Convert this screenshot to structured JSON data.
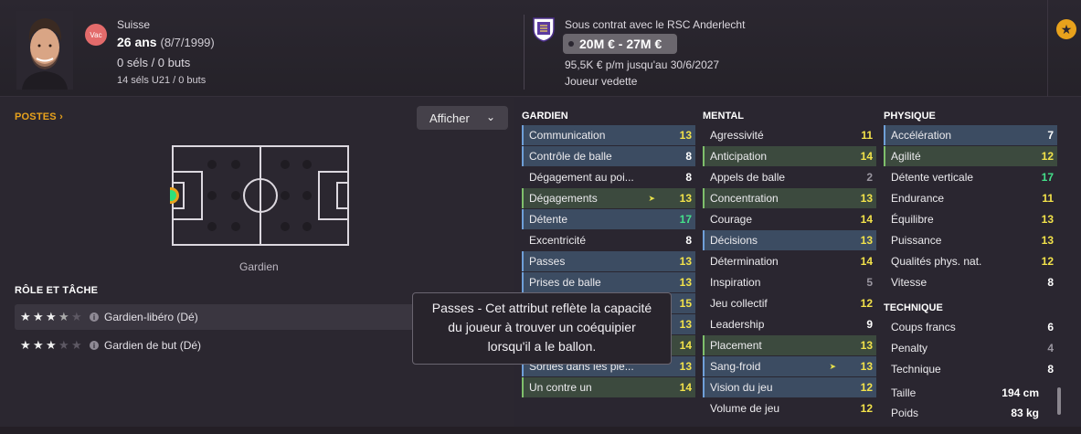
{
  "header": {
    "vac_badge": "Vac",
    "nationality": "Suisse",
    "age": "26 ans",
    "dob": "(8/7/1999)",
    "caps": "0 séls / 0 buts",
    "caps_u21": "14 séls U21 / 0 buts",
    "contract_line": "Sous contrat avec le RSC Anderlecht",
    "value_range": "20M € - 27M €",
    "wage_line": "95,5K € p/m jusqu'au 30/6/2027",
    "status_line": "Joueur vedette",
    "star_icon": "star-icon"
  },
  "positions": {
    "title": "POSTES ›",
    "dropdown_label": "Afficher",
    "dropdown_icon": "chevron-down-icon",
    "position_label": "Gardien"
  },
  "roles": {
    "title": "RÔLE ET TÂCHE",
    "items": [
      {
        "label": "Gardien-libéro (Dé)",
        "stars": 3.5
      },
      {
        "label": "Gardien de but (Dé)",
        "stars": 3
      }
    ]
  },
  "goalkeeping": {
    "title": "GARDIEN",
    "attributes": [
      {
        "name": "Communication",
        "value": "13"
      },
      {
        "name": "Contrôle de balle",
        "value": "8"
      },
      {
        "name": "Dégagement au poi...",
        "value": "8"
      },
      {
        "name": "Dégagements",
        "value": "13"
      },
      {
        "name": "Détente",
        "value": "17"
      },
      {
        "name": "Excentricité",
        "value": "8"
      },
      {
        "name": "Passes",
        "value": "13"
      },
      {
        "name": "Prises de balle",
        "value": "13"
      },
      {
        "name": "",
        "value": "15"
      },
      {
        "name": "",
        "value": "13"
      },
      {
        "name": "",
        "value": "14"
      },
      {
        "name": "Sorties dans les pie...",
        "value": "13"
      },
      {
        "name": "Un contre un",
        "value": "14"
      }
    ]
  },
  "mental": {
    "title": "MENTAL",
    "attributes": [
      {
        "name": "Agressivité",
        "value": "11"
      },
      {
        "name": "Anticipation",
        "value": "14"
      },
      {
        "name": "Appels de balle",
        "value": "2"
      },
      {
        "name": "Concentration",
        "value": "13"
      },
      {
        "name": "Courage",
        "value": "14"
      },
      {
        "name": "Décisions",
        "value": "13"
      },
      {
        "name": "Détermination",
        "value": "14"
      },
      {
        "name": "Inspiration",
        "value": "5"
      },
      {
        "name": "Jeu collectif",
        "value": "12"
      },
      {
        "name": "Leadership",
        "value": "9"
      },
      {
        "name": "Placement",
        "value": "13"
      },
      {
        "name": "Sang-froid",
        "value": "13"
      },
      {
        "name": "Vision du jeu",
        "value": "12"
      },
      {
        "name": "Volume de jeu",
        "value": "12"
      }
    ]
  },
  "physical": {
    "title": "PHYSIQUE",
    "attributes": [
      {
        "name": "Accélération",
        "value": "7"
      },
      {
        "name": "Agilité",
        "value": "12"
      },
      {
        "name": "Détente verticale",
        "value": "17"
      },
      {
        "name": "Endurance",
        "value": "11"
      },
      {
        "name": "Équilibre",
        "value": "13"
      },
      {
        "name": "Puissance",
        "value": "13"
      },
      {
        "name": "Qualités phys. nat.",
        "value": "12"
      },
      {
        "name": "Vitesse",
        "value": "8"
      }
    ]
  },
  "technical": {
    "title": "TECHNIQUE",
    "attributes": [
      {
        "name": "Coups francs",
        "value": "6"
      },
      {
        "name": "Penalty",
        "value": "4"
      },
      {
        "name": "Technique",
        "value": "8"
      }
    ]
  },
  "body": {
    "height_label": "Taille",
    "height_value": "194 cm",
    "weight_label": "Poids",
    "weight_value": "83 kg"
  },
  "tooltip": {
    "line1": "Passes - Cet attribut reflète la capacité",
    "line2": "du joueur à trouver un coéquipier",
    "line3": "lorsqu'il a le ballon."
  },
  "colors": {
    "accent": "#e8a21c",
    "highlight_blue": "#3c4c62",
    "highlight_green": "#3c4a3e",
    "value_green": "#44e08a",
    "value_yellow": "#f2e24a"
  }
}
